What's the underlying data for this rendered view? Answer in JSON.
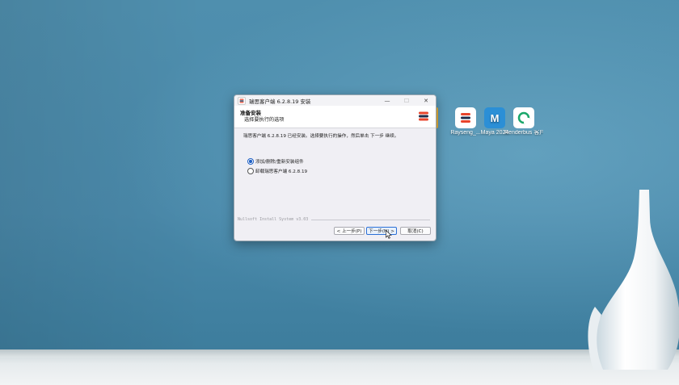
{
  "desktop": {
    "icons": [
      {
        "label": "Rayseng_...",
        "icon": "rayseng-icon",
        "color": "#ffffff"
      },
      {
        "label": "Maya 2024",
        "icon": "maya-icon",
        "color": "#2b8fd6"
      },
      {
        "label": "Renderbus 客户端",
        "icon": "renderbus-icon",
        "color": "#ffffff"
      }
    ],
    "partial_icon_label": "...",
    "wallpaper_accent": "#4a89aa"
  },
  "installer": {
    "window_title": "瑞思客户端 6.2.8.19 安装",
    "controls": {
      "minimize": "—",
      "maximize": "☐",
      "close": "✕"
    },
    "header": {
      "title": "准备安装",
      "subtitle": "选择要执行的选项"
    },
    "message": "瑞思客户端 6.2.8.19 已经安装。选择要执行的操作，然后单击 下一步 继续。",
    "options": [
      {
        "label": "添加/删除/重新安装组件",
        "selected": true
      },
      {
        "label": "卸载瑞思客户端 6.2.8.19",
        "selected": false
      }
    ],
    "branding": "Nullsoft Install System v3.03",
    "buttons": {
      "back": "< 上一步(P)",
      "next": "下一步(N) >",
      "cancel": "取消(C)"
    },
    "accent": "#2a6fd6",
    "logo_colors": [
      "#e8452c",
      "#1d2b4a"
    ]
  }
}
